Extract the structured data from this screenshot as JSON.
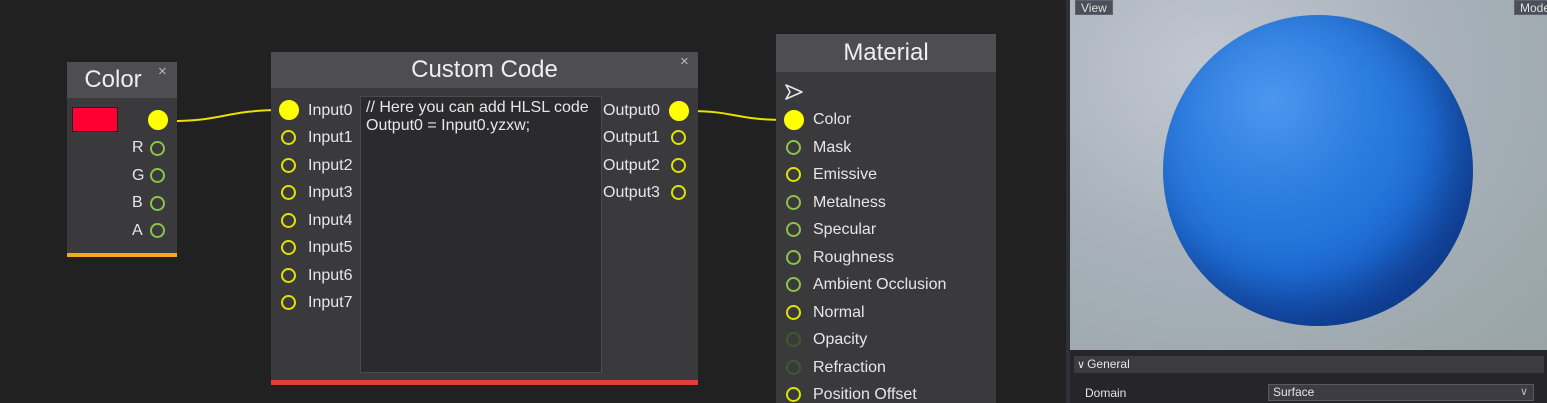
{
  "color_node": {
    "title": "Color",
    "close": "×",
    "swatch_color": "#ff0033",
    "outputs": [
      "R",
      "G",
      "B",
      "A"
    ],
    "accent_color": "#f5a623"
  },
  "custom_code_node": {
    "title": "Custom Code",
    "close": "×",
    "inputs": [
      "Input0",
      "Input1",
      "Input2",
      "Input3",
      "Input4",
      "Input5",
      "Input6",
      "Input7"
    ],
    "outputs": [
      "Output0",
      "Output1",
      "Output2",
      "Output3"
    ],
    "code": "// Here you can add HLSL code\nOutput0 = Input0.yzxw;",
    "accent_color": "#e0403a"
  },
  "material_node": {
    "title": "Material",
    "arrow_icon": "send-arrow-icon",
    "inputs": [
      "Color",
      "Mask",
      "Emissive",
      "Metalness",
      "Specular",
      "Roughness",
      "Ambient Occlusion",
      "Normal",
      "Opacity",
      "Refraction",
      "Position Offset"
    ]
  },
  "preview": {
    "view_button": "View",
    "mode_button": "Mode"
  },
  "properties": {
    "group_title": "General",
    "domain_label": "Domain",
    "domain_value": "Surface"
  },
  "colors": {
    "wire": "#e8e000",
    "port_yellow": "#ffff00",
    "port_green": "#8bc34a",
    "sphere": "#1f6fd8"
  }
}
